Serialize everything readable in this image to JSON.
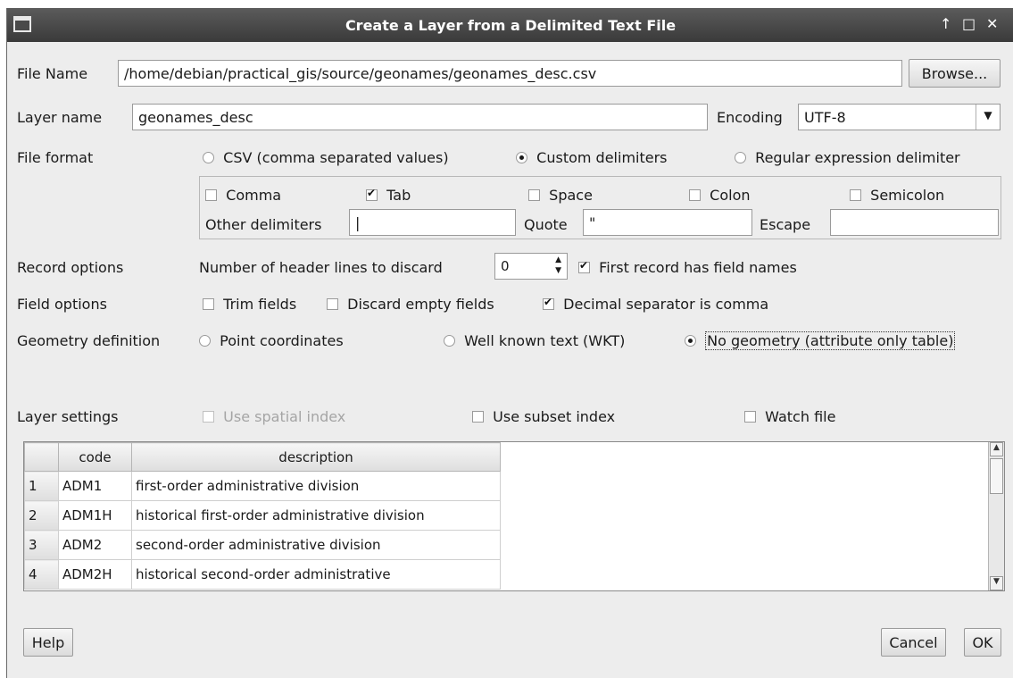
{
  "window": {
    "title": "Create a Layer from a Delimited Text File",
    "controls": [
      "↑",
      "□",
      "✕"
    ]
  },
  "file_name": {
    "label": "File Name",
    "value": "/home/debian/practical_gis/source/geonames/geonames_desc.csv",
    "browse": "Browse..."
  },
  "layer_name": {
    "label": "Layer name",
    "value": "geonames_desc"
  },
  "encoding": {
    "label": "Encoding",
    "value": "UTF-8"
  },
  "file_format": {
    "label": "File format",
    "options": [
      "CSV (comma separated values)",
      "Custom delimiters",
      "Regular expression delimiter"
    ],
    "selected": "Custom delimiters"
  },
  "delimiters": {
    "comma": "Comma",
    "tab": "Tab",
    "space": "Space",
    "colon": "Colon",
    "semicolon": "Semicolon",
    "other_label": "Other delimiters",
    "other_value": "|",
    "quote_label": "Quote",
    "quote_value": "\"",
    "escape_label": "Escape",
    "escape_value": "",
    "checked": [
      "Tab"
    ]
  },
  "record_options": {
    "label": "Record options",
    "header_lines_label": "Number of header lines to discard",
    "header_lines_value": "0",
    "first_record_label": "First record has field names",
    "first_record_checked": true
  },
  "field_options": {
    "label": "Field options",
    "trim": "Trim fields",
    "trim_checked": false,
    "discard_empty": "Discard empty fields",
    "discard_empty_checked": false,
    "decimal_comma": "Decimal separator is comma",
    "decimal_comma_checked": true
  },
  "geometry": {
    "label": "Geometry definition",
    "options": [
      "Point coordinates",
      "Well known text (WKT)",
      "No geometry (attribute only table)"
    ],
    "selected": "No geometry (attribute only table)"
  },
  "layer_settings": {
    "label": "Layer settings",
    "spatial_index": "Use spatial index",
    "subset_index": "Use subset index",
    "watch_file": "Watch file"
  },
  "table": {
    "columns": [
      "code",
      "description"
    ],
    "rows": [
      {
        "n": "1",
        "code": "ADM1",
        "description": "first-order administrative division"
      },
      {
        "n": "2",
        "code": "ADM1H",
        "description": "historical first-order administrative division"
      },
      {
        "n": "3",
        "code": "ADM2",
        "description": "second-order administrative division"
      },
      {
        "n": "4",
        "code": "ADM2H",
        "description": "historical second-order administrative"
      }
    ]
  },
  "buttons": {
    "help": "Help",
    "cancel": "Cancel",
    "ok": "OK"
  }
}
